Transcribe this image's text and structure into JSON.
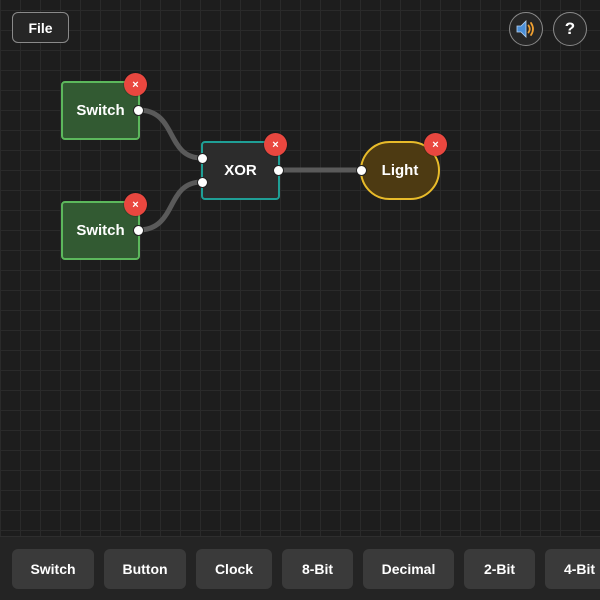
{
  "header": {
    "file_label": "File",
    "sound_icon": "speaker-icon",
    "help_label": "?"
  },
  "nodes": {
    "switch1": {
      "label": "Switch"
    },
    "switch2": {
      "label": "Switch"
    },
    "gate": {
      "label": "XOR"
    },
    "light": {
      "label": "Light"
    }
  },
  "delete_glyph": "×",
  "toolbar": {
    "items": [
      {
        "label": "Switch"
      },
      {
        "label": "Button"
      },
      {
        "label": "Clock"
      },
      {
        "label": "8-Bit"
      },
      {
        "label": "Decimal"
      },
      {
        "label": "2-Bit"
      },
      {
        "label": "4-Bit"
      }
    ]
  },
  "colors": {
    "background": "#1d1d1d",
    "switch_border": "#5cb85c",
    "switch_fill": "#325a32",
    "gate_border": "#1f9f96",
    "light_border": "#e8bb2a",
    "light_fill": "#4d3a12",
    "delete": "#e9473f",
    "wire": "#5a5a5a"
  }
}
